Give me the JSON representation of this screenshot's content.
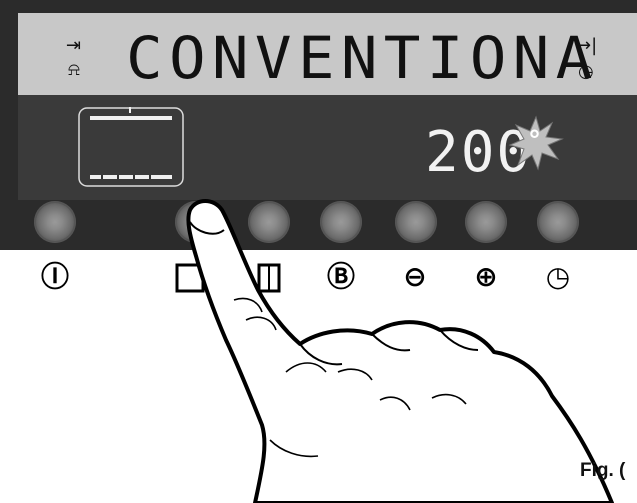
{
  "display": {
    "program_text": "CONVENTIONA",
    "temperature": "200",
    "temperature_unit": "°",
    "left_icon_top": "⇥",
    "left_icon_bottom": "🔔",
    "right_icon_top": "→|",
    "right_icon_bottom": "◷"
  },
  "buttons": [
    {
      "symbol": "Ⓘ",
      "icon": "power-icon"
    },
    {
      "symbol": "",
      "icon": "function-select-icon"
    },
    {
      "symbol": "",
      "icon": "function-select-icon"
    },
    {
      "symbol": "Ⓑ",
      "icon": "b-icon"
    },
    {
      "symbol": "⊖",
      "icon": "minus-icon"
    },
    {
      "symbol": "⊕",
      "icon": "plus-icon"
    },
    {
      "symbol": "◷",
      "icon": "clock-icon"
    }
  ],
  "figure_label": "Fig. (",
  "colors": {
    "panel": "#2b2b2b",
    "lcd": "#c8c8c8",
    "display_text": "#f2f2f2"
  }
}
